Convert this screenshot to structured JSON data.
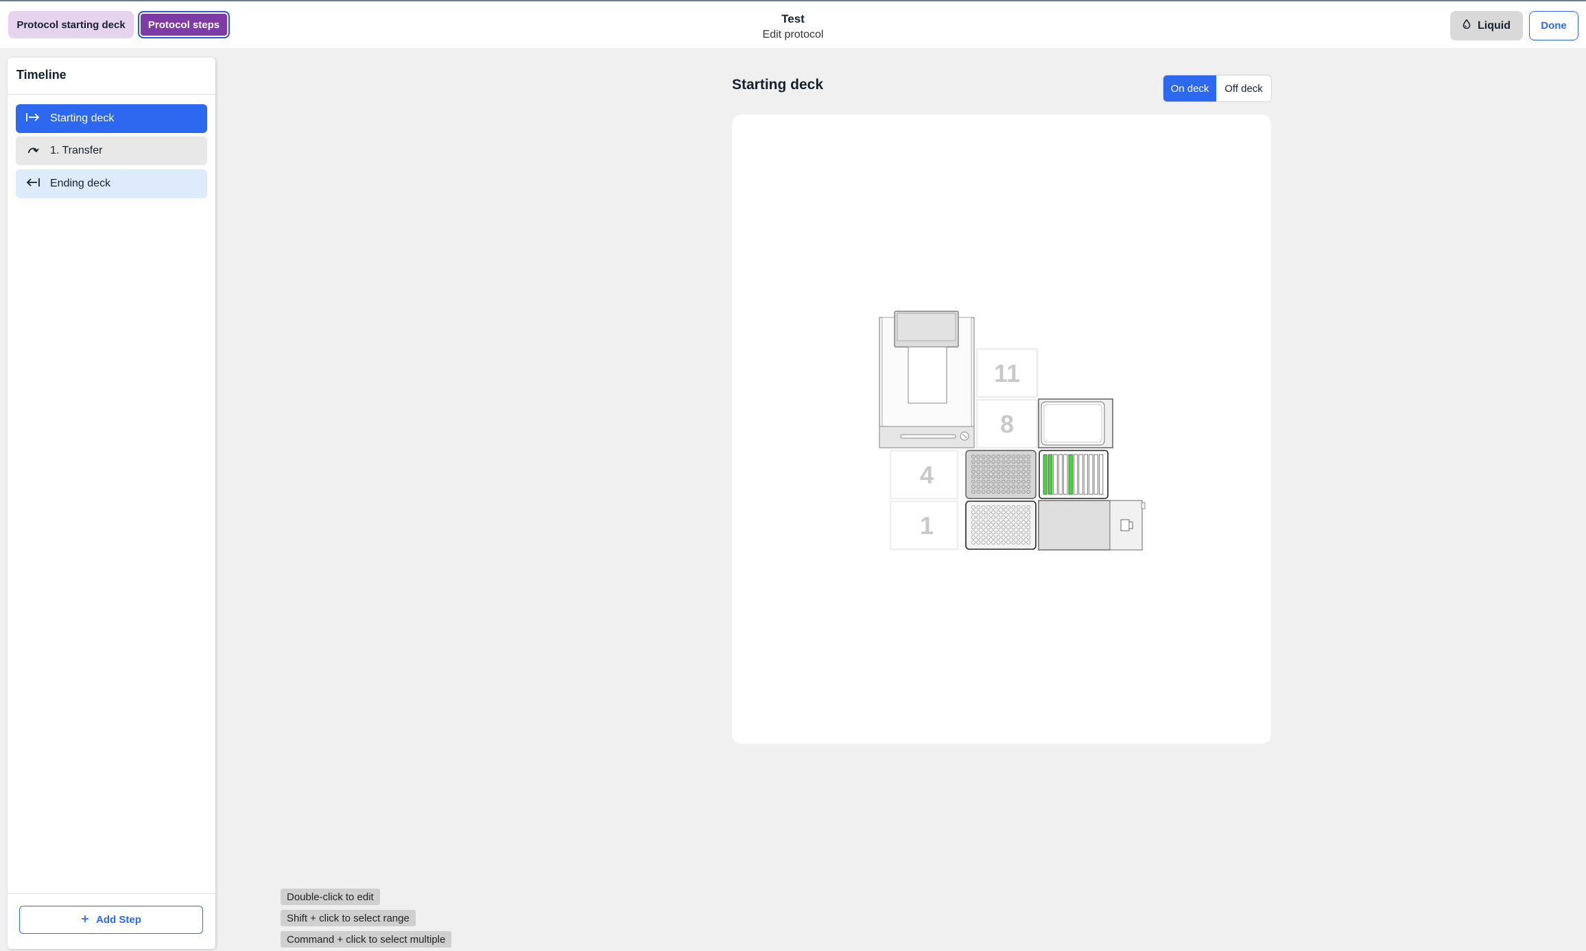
{
  "header": {
    "tab_starting_deck": "Protocol starting deck",
    "tab_protocol_steps": "Protocol steps",
    "title": "Test",
    "subtitle": "Edit protocol",
    "liquid_button": "Liquid",
    "done_button": "Done"
  },
  "sidebar": {
    "title": "Timeline",
    "steps": [
      {
        "label": "Starting deck",
        "icon": "arrow-right-from-line-icon",
        "state": "selected"
      },
      {
        "label": "1. Transfer",
        "icon": "curved-arrow-icon",
        "state": "default"
      },
      {
        "label": "Ending deck",
        "icon": "arrow-left-to-line-icon",
        "state": "highlighted"
      }
    ],
    "add_step": "Add Step"
  },
  "deck": {
    "title": "Starting deck",
    "toggle_on": "On deck",
    "toggle_off": "Off deck",
    "toggle_selected": "On deck",
    "slot_labels": [
      "11",
      "8",
      "4",
      "1"
    ]
  },
  "hints": [
    "Double-click to edit",
    "Shift + click to select range",
    "Command + click to select multiple"
  ],
  "colors": {
    "accent_blue": "#2d68f0",
    "purple": "#7e3aa5",
    "light_purple": "#e6d4ee",
    "liquid_green": "#3ddc2e"
  }
}
